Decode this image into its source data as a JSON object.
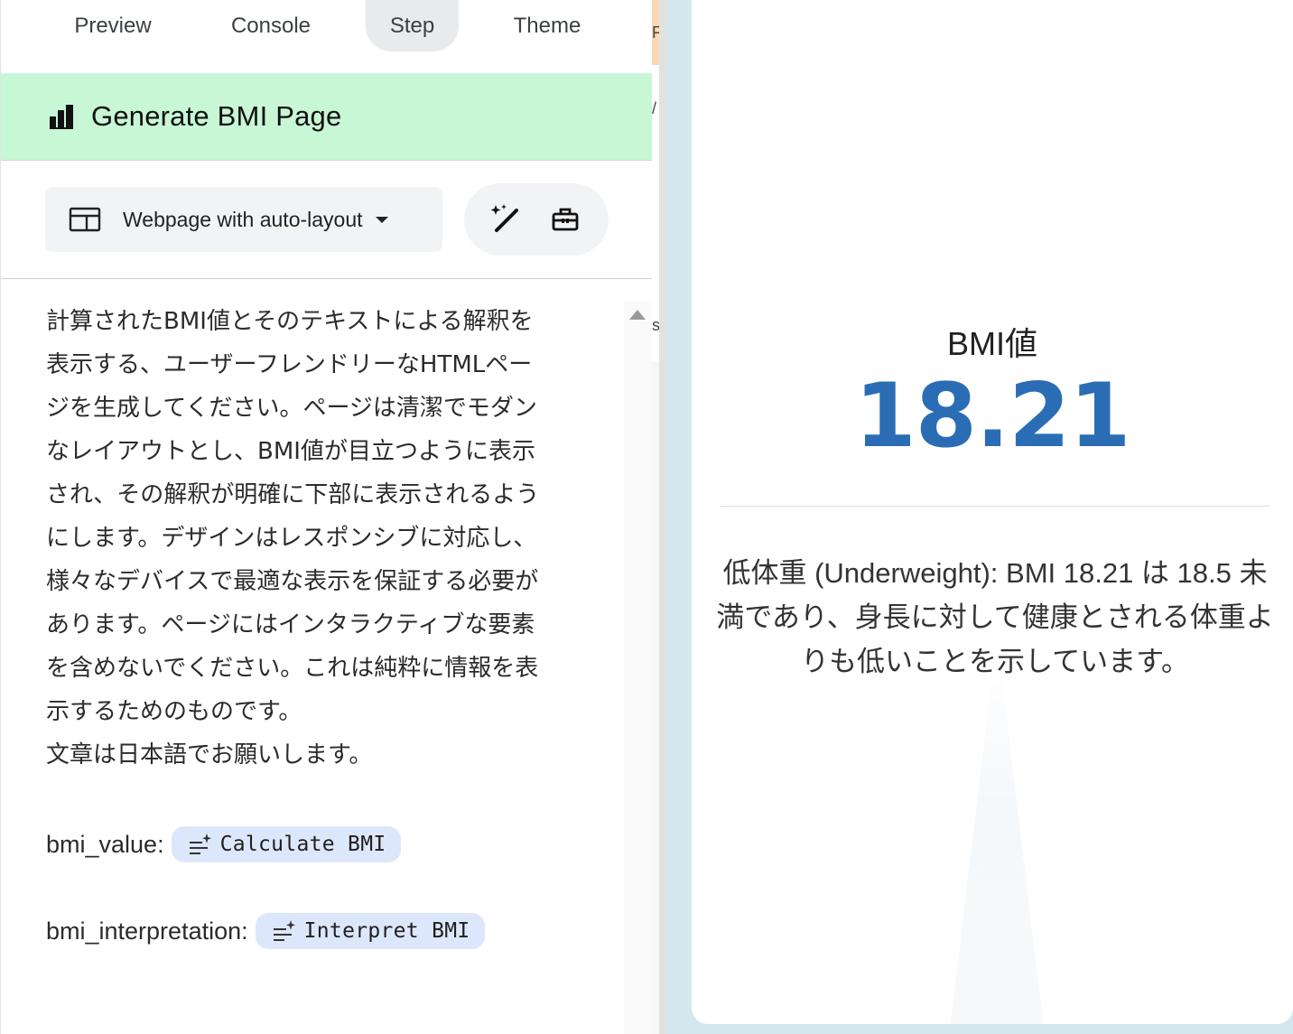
{
  "tabs": [
    {
      "label": "Preview"
    },
    {
      "label": "Console"
    },
    {
      "label": "Step"
    },
    {
      "label": "Theme"
    }
  ],
  "header": {
    "title": "Generate BMI Page",
    "icon": "bar-chart-icon",
    "background": "#c8f7d5"
  },
  "toolbar": {
    "layout_label": "Webpage with auto-layout",
    "layout_icon": "layout-icon",
    "magic_icon": "magic-wand-icon",
    "tools_icon": "toolbox-icon"
  },
  "prompt": {
    "text": "計算されたBMI値とそのテキストによる解釈を\n表示する、ユーザーフレンドリーなHTMLペー\nジを生成してください。ページは清潔でモダン\nなレイアウトとし、BMI値が目立つように表示\nされ、その解釈が明確に下部に表示されるよう\nにします。デザインはレスポンシブに対応し、\n様々なデバイスで最適な表示を保証する必要が\nあります。ページにはインタラクティブな要素\nを含めないでください。これは純粋に情報を表\n示するためのものです。\n文章は日本語でお願いします。"
  },
  "variables": [
    {
      "label": "bmi_value:",
      "chip": "Calculate BMI",
      "icon": "sparkle-list-icon"
    },
    {
      "label": "bmi_interpretation:",
      "chip": "Interpret BMI",
      "icon": "sparkle-list-icon"
    }
  ],
  "sliver": {
    "glyph_top": "F",
    "glyph_mid": "/",
    "glyph_low": "s"
  },
  "preview": {
    "bmi_label": "BMI値",
    "bmi_value": "18.21",
    "interpretation": "低体重 (Underweight): BMI 18.21 は 18.5 未満であり、身長に対して健康とされる体重よりも低いことを示しています。",
    "accent": "#2a6db5",
    "background": "#d3e7ee"
  }
}
